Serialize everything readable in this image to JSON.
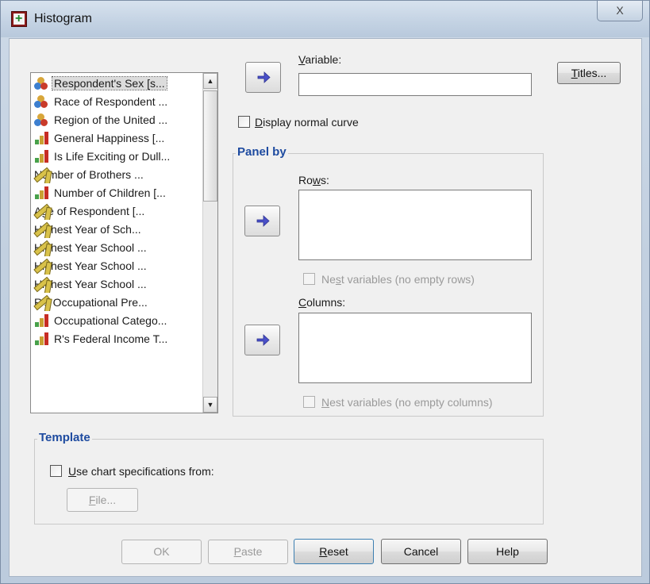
{
  "window": {
    "title": "Histogram",
    "close_glyph": "X"
  },
  "variable_list": {
    "items": [
      {
        "label": "Respondent's Sex [s...",
        "type": "nominal"
      },
      {
        "label": "Race of Respondent ...",
        "type": "nominal"
      },
      {
        "label": "Region of the United ...",
        "type": "nominal"
      },
      {
        "label": "General Happiness [...",
        "type": "ordinal"
      },
      {
        "label": "Is Life Exciting or Dull...",
        "type": "ordinal"
      },
      {
        "label": "Number of Brothers ...",
        "type": "scale"
      },
      {
        "label": "Number of Children [...",
        "type": "ordinal"
      },
      {
        "label": "Age of Respondent [...",
        "type": "scale"
      },
      {
        "label": "Highest Year of Sch...",
        "type": "scale"
      },
      {
        "label": "Highest Year School ...",
        "type": "scale"
      },
      {
        "label": "Highest Year School ...",
        "type": "scale"
      },
      {
        "label": "Highest Year School ...",
        "type": "scale"
      },
      {
        "label": "R's Occupational Pre...",
        "type": "scale"
      },
      {
        "label": "Occupational Catego...",
        "type": "ordinal"
      },
      {
        "label": "R's Federal Income T...",
        "type": "ordinal"
      }
    ]
  },
  "variable": {
    "label": "Variable:",
    "value": ""
  },
  "titles_button": "Titles...",
  "display_normal_curve": {
    "label": "Display normal curve",
    "checked": false
  },
  "panel_by": {
    "title": "Panel by",
    "rows_label": "Rows:",
    "nest_rows_label": "Nest variables (no empty rows)",
    "columns_label": "Columns:",
    "nest_columns_label": "Nest variables (no empty columns)"
  },
  "template": {
    "title": "Template",
    "use_spec_label": "Use chart specifications from:",
    "file_button": "File..."
  },
  "buttons": {
    "ok": "OK",
    "paste": "Paste",
    "reset": "Reset",
    "cancel": "Cancel",
    "help": "Help"
  },
  "colors": {
    "group_title": "#1e4ba0",
    "arrow": "#4a50c8",
    "window_frame": "#c2d0e0"
  },
  "icons": {
    "move_arrow": "right-arrow-icon",
    "nominal": "nominal-measure-icon",
    "ordinal": "ordinal-measure-icon",
    "scale": "scale-measure-icon"
  }
}
